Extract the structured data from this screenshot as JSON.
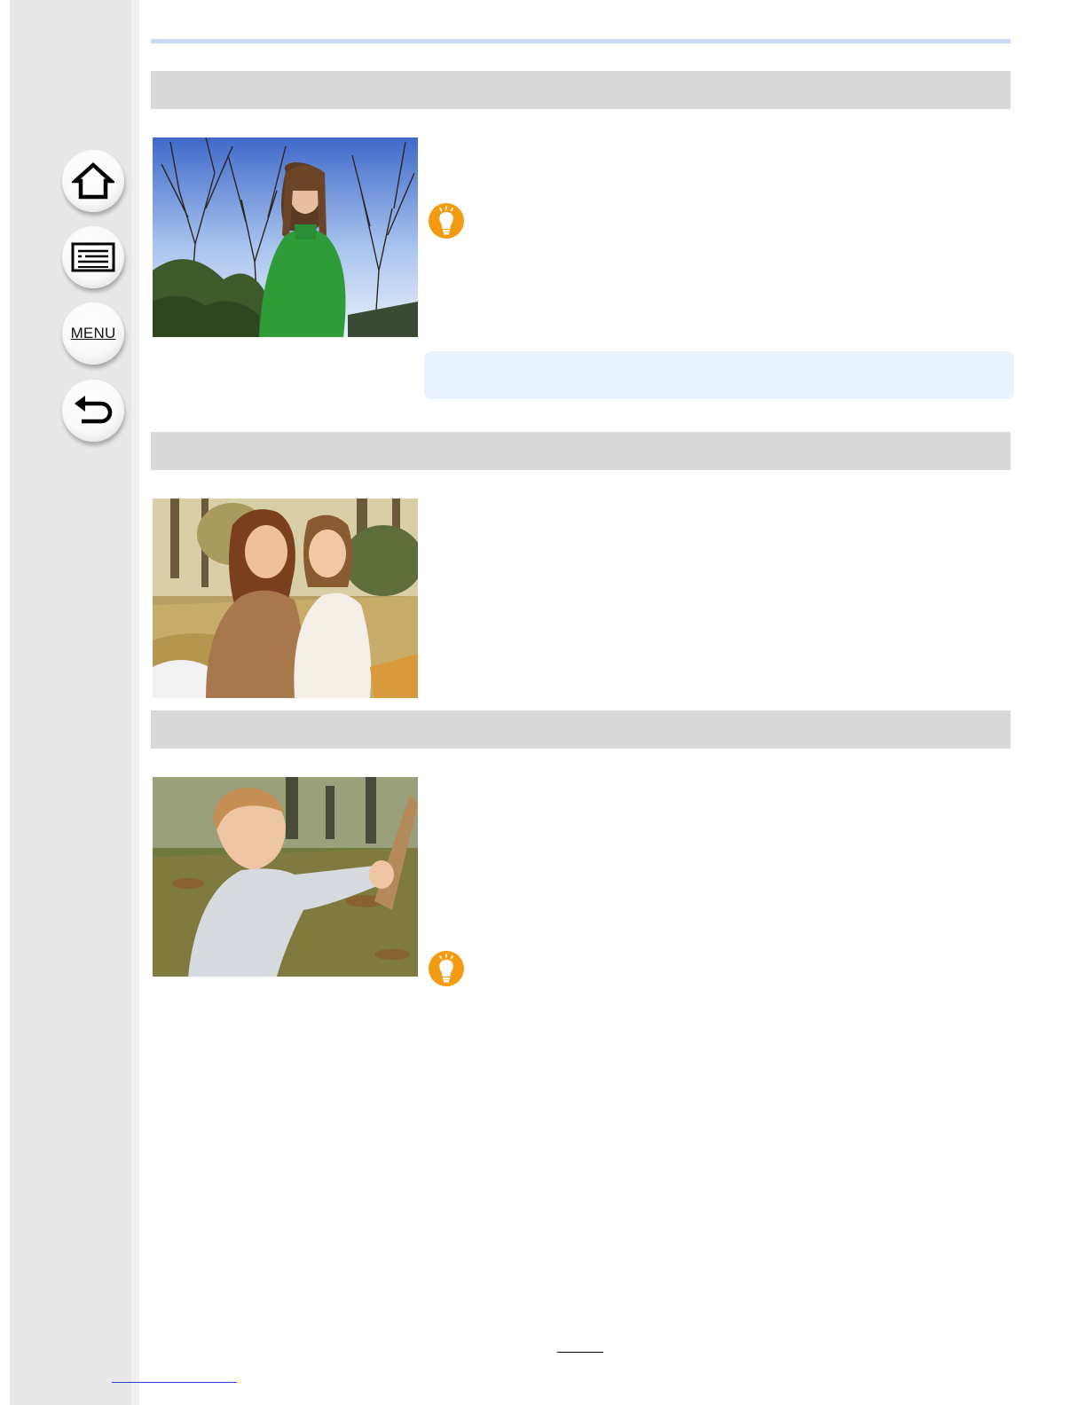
{
  "navigation": {
    "home": {
      "icon": "home-icon"
    },
    "contents": {
      "icon": "list-icon"
    },
    "menu": {
      "label": "MENU"
    },
    "back": {
      "icon": "back-arrow-icon"
    }
  },
  "sections": [
    {
      "photo": "portrait-woman-green-sweater-bare-trees",
      "tip_icon": "lightbulb-icon",
      "has_note": true
    },
    {
      "photo": "two-women-smiling-autumn-park"
    },
    {
      "photo": "toddler-holding-stick-outdoors",
      "tip_icon": "lightbulb-icon"
    }
  ],
  "colors": {
    "sidebar": "#e8e8e8",
    "section_bar": "#d9d9d9",
    "top_rule": "#c9d9f5",
    "note_box": "#eaf1ff",
    "tip_icon": "#f39c12",
    "link": "#2a3fd6"
  }
}
